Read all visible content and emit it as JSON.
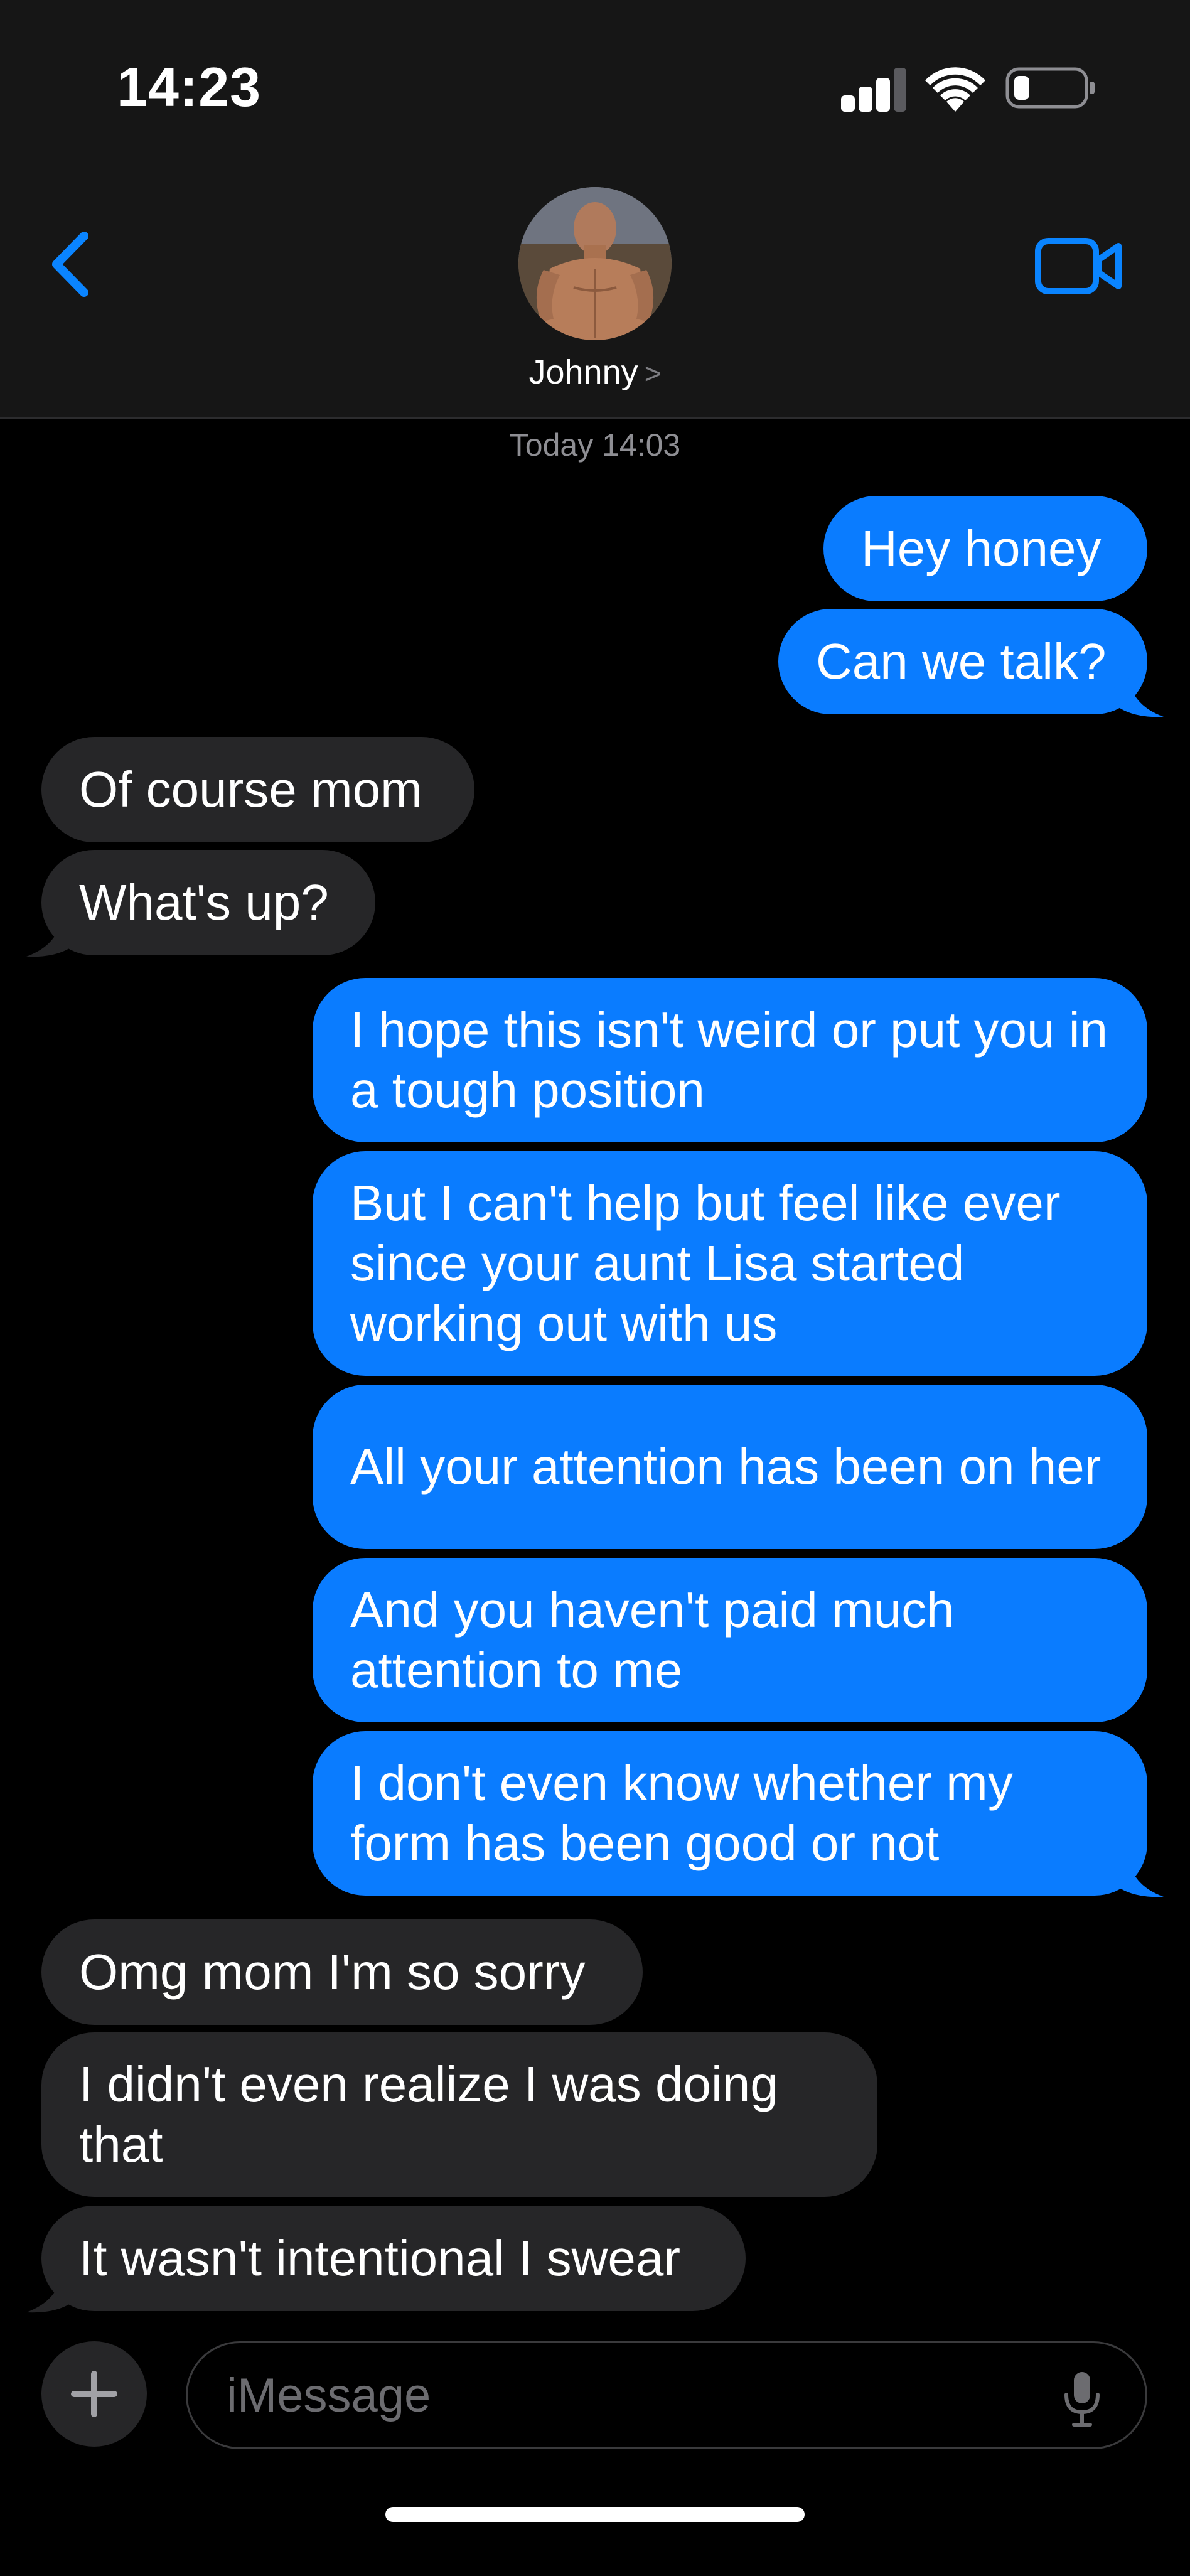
{
  "status_bar": {
    "time": "14:23",
    "signal_icon": "cellular-signal-icon",
    "wifi_icon": "wifi-icon",
    "battery_icon": "battery-low-icon",
    "battery_level": 0.2
  },
  "header": {
    "back_icon": "chevron-left-icon",
    "contact_name": "Johnny",
    "contact_chevron": ">",
    "video_icon": "video-camera-icon"
  },
  "thread": {
    "timestamp": "Today 14:03",
    "messages": [
      {
        "direction": "outgoing",
        "text": "Hey honey"
      },
      {
        "direction": "outgoing",
        "text": "Can we talk?"
      },
      {
        "direction": "incoming",
        "text": "Of course mom"
      },
      {
        "direction": "incoming",
        "text": "What's up?"
      },
      {
        "direction": "outgoing",
        "text": "I hope this isn't weird or put you in a tough position"
      },
      {
        "direction": "outgoing",
        "text": "But I can't help but feel like ever since your aunt Lisa started working out with us"
      },
      {
        "direction": "outgoing",
        "text": "All your attention has been on her"
      },
      {
        "direction": "outgoing",
        "text": "And you haven't paid much attention to me"
      },
      {
        "direction": "outgoing",
        "text": "I don't even know whether my form has been good or not"
      },
      {
        "direction": "incoming",
        "text": "Omg mom I'm so sorry"
      },
      {
        "direction": "incoming",
        "text": "I didn't even realize I was doing that"
      },
      {
        "direction": "incoming",
        "text": "It wasn't intentional I swear"
      }
    ]
  },
  "composer": {
    "plus_label": "+",
    "placeholder": "iMessage",
    "mic_icon": "microphone-icon"
  },
  "colors": {
    "outgoing_bubble": "#0a7cff",
    "incoming_bubble": "#262628",
    "accent": "#0a84ff",
    "background": "#000000",
    "header_background": "#161616"
  }
}
